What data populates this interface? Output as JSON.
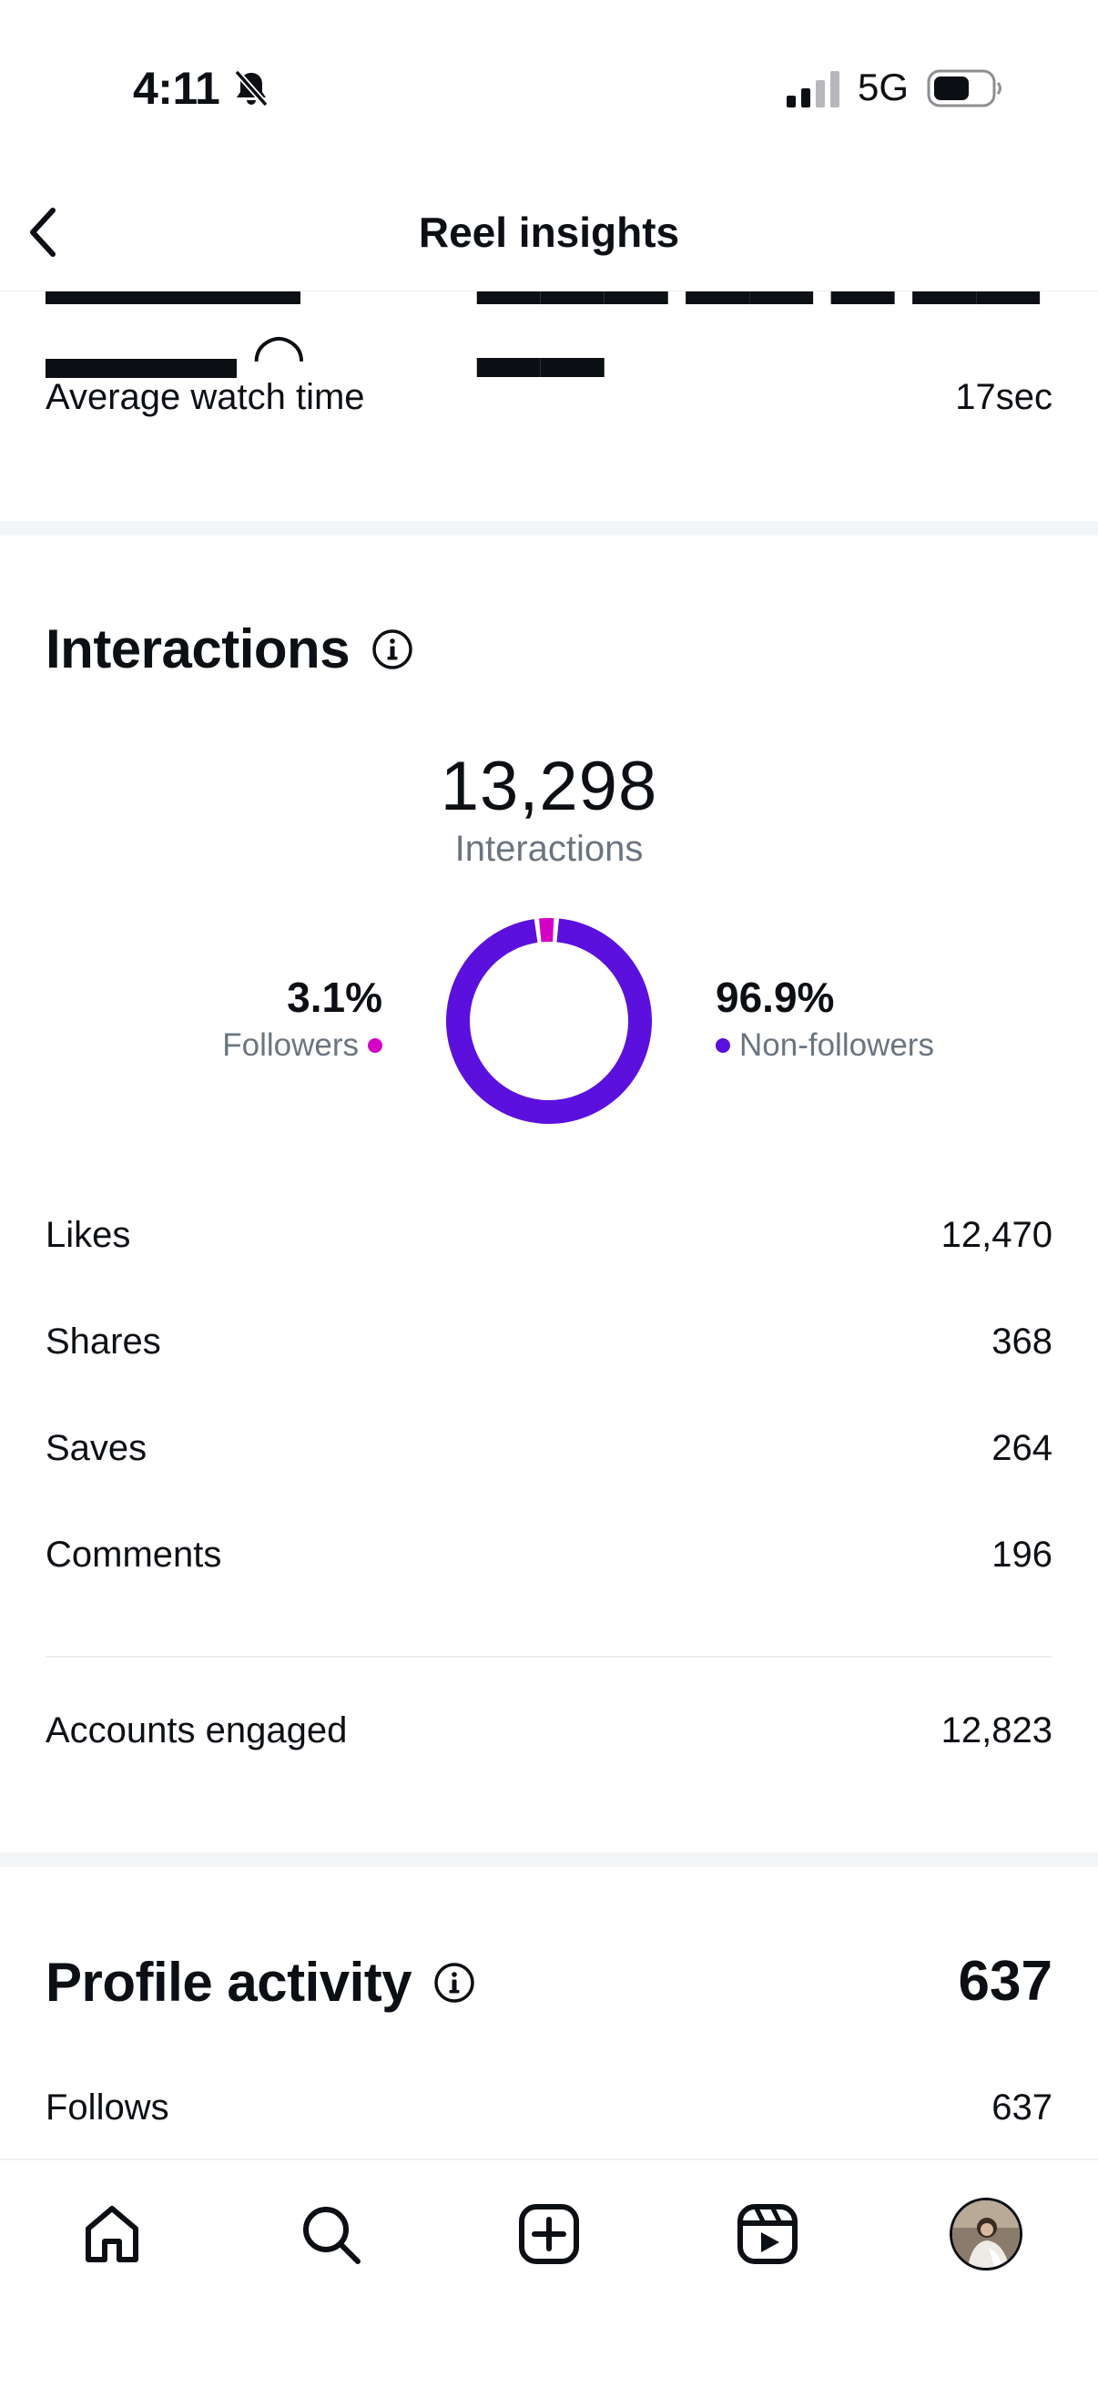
{
  "status_bar": {
    "time": "4:11",
    "network": "5G"
  },
  "header": {
    "title": "Reel insights"
  },
  "watch_time": {
    "average_label": "Average watch time",
    "average_value": "17sec"
  },
  "interactions": {
    "title": "Interactions",
    "total": "13,298",
    "total_label": "Interactions",
    "followers_pct": "3.1%",
    "followers_label": "Followers",
    "non_followers_pct": "96.9%",
    "non_followers_label": "Non-followers",
    "rows": [
      {
        "label": "Likes",
        "value": "12,470"
      },
      {
        "label": "Shares",
        "value": "368"
      },
      {
        "label": "Saves",
        "value": "264"
      },
      {
        "label": "Comments",
        "value": "196"
      }
    ],
    "accounts_engaged_label": "Accounts engaged",
    "accounts_engaged_value": "12,823"
  },
  "profile_activity": {
    "title": "Profile activity",
    "total": "637",
    "follows_label": "Follows",
    "follows_value": "637"
  },
  "donut_chart": {
    "type": "pie",
    "series": [
      {
        "name": "Followers",
        "value": 3.1,
        "color": "#d300c5"
      },
      {
        "name": "Non-followers",
        "value": 96.9,
        "color": "#5b10dd"
      }
    ]
  },
  "tabs": [
    "home-icon",
    "search-icon",
    "create-icon",
    "reels-icon",
    "profile-avatar"
  ],
  "colors": {
    "accent_purple": "#5b10dd",
    "accent_magenta": "#d300c5"
  }
}
